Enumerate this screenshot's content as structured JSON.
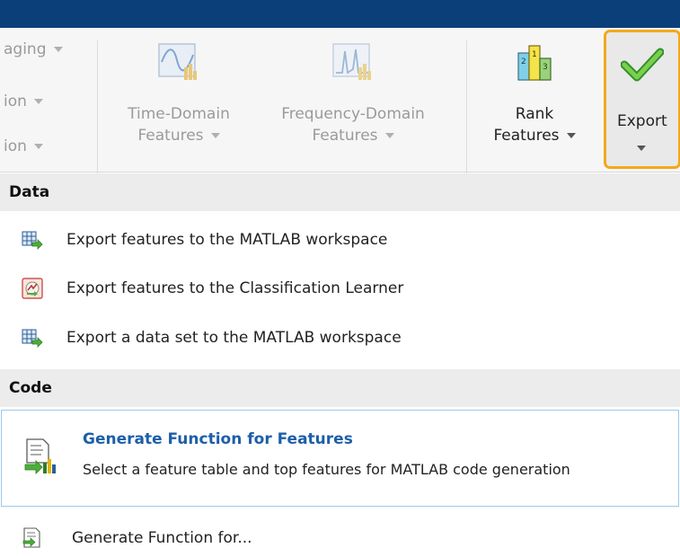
{
  "toolstrip": {
    "partial_col": [
      "aging",
      "ion",
      "ion"
    ],
    "time_domain": {
      "line1": "Time-Domain",
      "line2": "Features"
    },
    "freq_domain": {
      "line1": "Frequency-Domain",
      "line2": "Features"
    },
    "rank": {
      "line1": "Rank",
      "line2": "Features"
    },
    "export": {
      "label": "Export"
    }
  },
  "menu": {
    "data_header": "Data",
    "data_items": [
      {
        "label": "Export features to the MATLAB workspace",
        "icon": "table-export-icon"
      },
      {
        "label": "Export features to the Classification Learner",
        "icon": "classification-learner-icon"
      },
      {
        "label": "Export a data set to the MATLAB workspace",
        "icon": "table-export-icon"
      }
    ],
    "code_header": "Code",
    "generate": {
      "title": "Generate Function for Features",
      "description": "Select a feature table and top features for MATLAB code generation"
    },
    "generate_for": "Generate Function for..."
  },
  "colors": {
    "titlebar": "#0a3f7a",
    "export_highlight": "#f3a81c",
    "link_blue": "#1d5fa8"
  }
}
